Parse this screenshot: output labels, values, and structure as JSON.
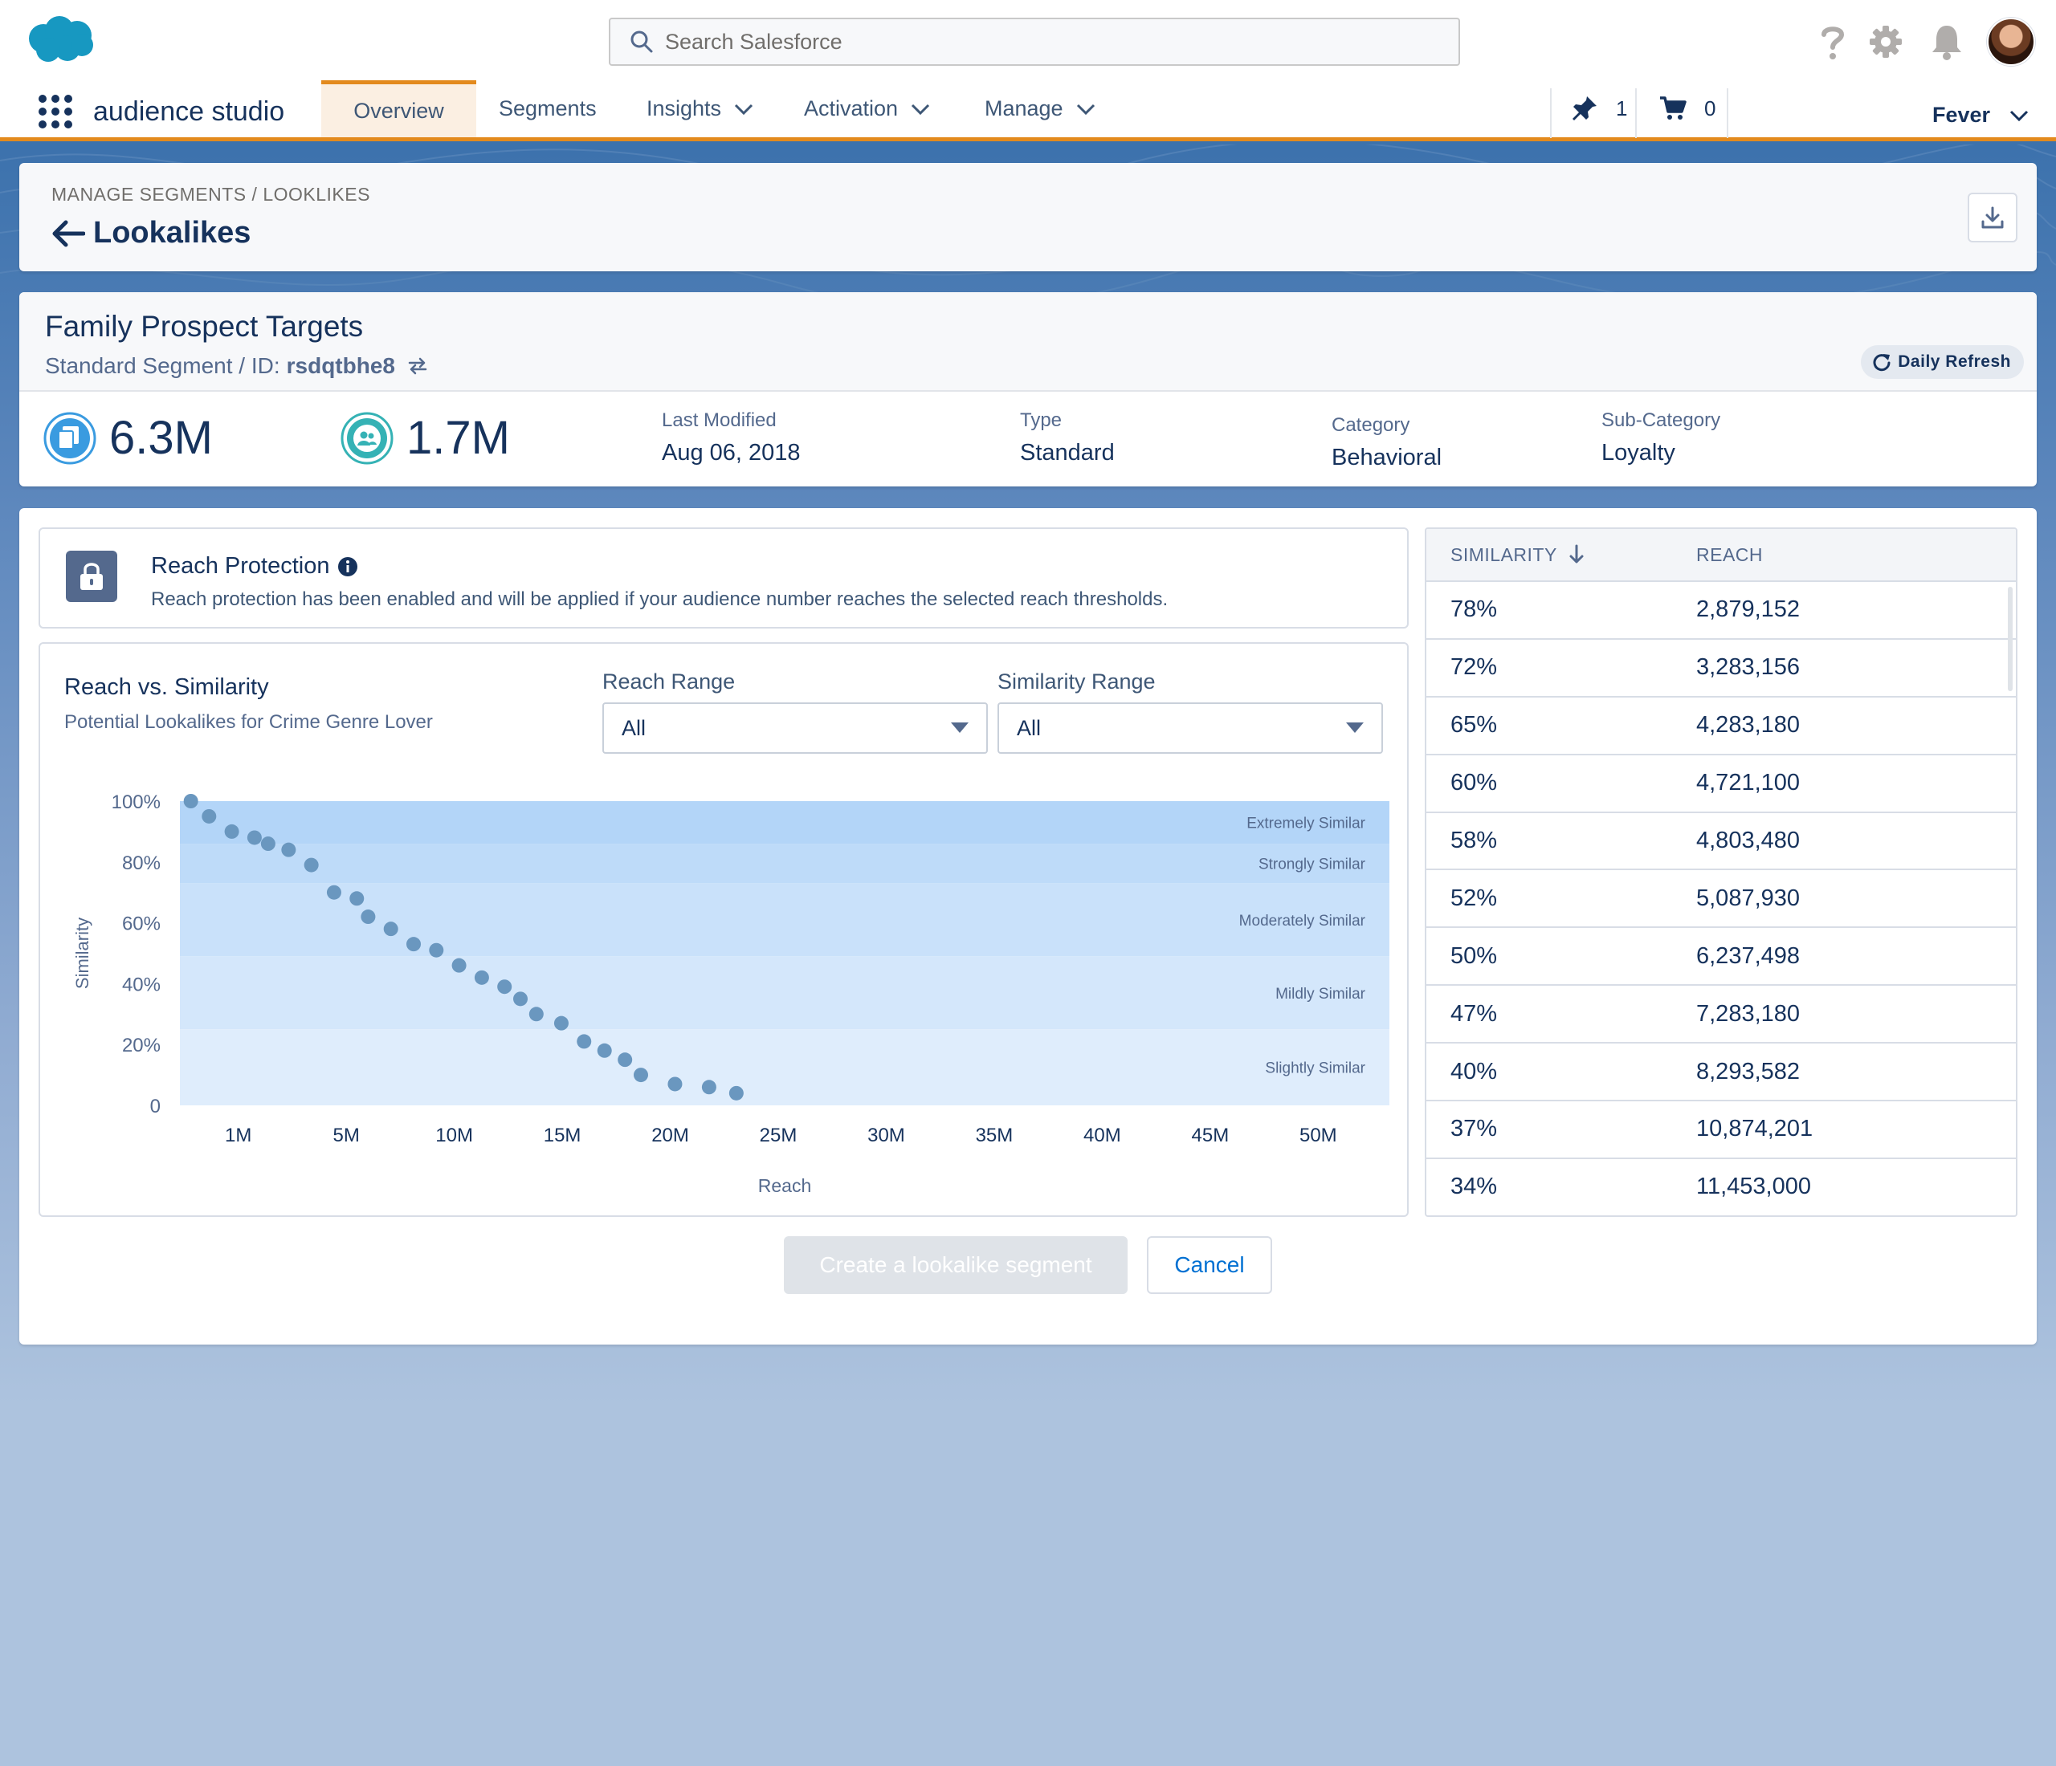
{
  "header": {
    "search_placeholder": "Search Salesforce",
    "icons": [
      "help-icon",
      "gear-icon",
      "bell-icon"
    ]
  },
  "nav": {
    "app_name": "audience studio",
    "tabs": [
      {
        "label": "Overview",
        "active": true
      },
      {
        "label": "Segments"
      },
      {
        "label": "Insights",
        "has_menu": true
      },
      {
        "label": "Activation",
        "has_menu": true
      },
      {
        "label": "Manage",
        "has_menu": true
      }
    ],
    "pin_count": "1",
    "cart_count": "0",
    "org_name": "Fever",
    "accent_color": "#e38a1d"
  },
  "page": {
    "breadcrumb": "MANAGE SEGMENTS / LOOKLIKES",
    "title": "Lookalikes"
  },
  "segment": {
    "name": "Family Prospect Targets",
    "subtype": "Standard Segment",
    "id_label": "/ ID:",
    "id": "rsdqtbhe8",
    "refresh_label": "Daily Refresh",
    "metric_1": "6.3M",
    "metric_2": "1.7M",
    "fields": [
      {
        "label": "Last Modified",
        "value": "Aug 06, 2018"
      },
      {
        "label": "Type",
        "value": "Standard"
      },
      {
        "label": "Category",
        "value": "Behavioral"
      },
      {
        "label": "Sub-Category",
        "value": "Loyalty"
      }
    ]
  },
  "reach_protection": {
    "title": "Reach Protection",
    "description": "Reach protection has been enabled and will be applied if your audience number reaches the selected reach thresholds."
  },
  "chart_panel": {
    "title": "Reach vs. Similarity",
    "subtitle": "Potential Lookalikes for Crime Genre Lover",
    "reach_range_label": "Reach Range",
    "reach_range_value": "All",
    "similarity_range_label": "Similarity Range",
    "similarity_range_value": "All"
  },
  "chart_data": {
    "type": "scatter",
    "title": "Reach vs. Similarity",
    "xlabel": "Reach",
    "ylabel": "Similarity",
    "x_ticks": [
      "1M",
      "5M",
      "10M",
      "15M",
      "20M",
      "25M",
      "30M",
      "35M",
      "40M",
      "45M",
      "50M"
    ],
    "y_ticks": [
      "0",
      "20%",
      "40%",
      "60%",
      "80%",
      "100%"
    ],
    "ylim": [
      0,
      100
    ],
    "point_color": "#6a97bf",
    "bands": [
      {
        "label": "Extremely Similar",
        "from": 86,
        "to": 100,
        "color": "#b3d5f8"
      },
      {
        "label": "Strongly Similar",
        "from": 73,
        "to": 86,
        "color": "#bedbf9"
      },
      {
        "label": "Moderately Similar",
        "from": 49,
        "to": 73,
        "color": "#c9e1fa"
      },
      {
        "label": "Mildly Similar",
        "from": 25,
        "to": 49,
        "color": "#d4e7fb"
      },
      {
        "label": "Slightly Similar",
        "from": 0,
        "to": 25,
        "color": "#dfedfc"
      }
    ],
    "points": [
      {
        "x": 0.2,
        "y": 100
      },
      {
        "x": 1.0,
        "y": 95
      },
      {
        "x": 2.0,
        "y": 90
      },
      {
        "x": 3.0,
        "y": 88
      },
      {
        "x": 3.6,
        "y": 86
      },
      {
        "x": 4.5,
        "y": 84
      },
      {
        "x": 5.5,
        "y": 79
      },
      {
        "x": 6.5,
        "y": 70
      },
      {
        "x": 7.5,
        "y": 68
      },
      {
        "x": 8.0,
        "y": 62
      },
      {
        "x": 9.0,
        "y": 58
      },
      {
        "x": 10.0,
        "y": 53
      },
      {
        "x": 11.0,
        "y": 51
      },
      {
        "x": 12.0,
        "y": 46
      },
      {
        "x": 13.0,
        "y": 42
      },
      {
        "x": 14.0,
        "y": 39
      },
      {
        "x": 14.7,
        "y": 35
      },
      {
        "x": 15.4,
        "y": 30
      },
      {
        "x": 16.5,
        "y": 27
      },
      {
        "x": 17.5,
        "y": 21
      },
      {
        "x": 18.4,
        "y": 18
      },
      {
        "x": 19.3,
        "y": 15
      },
      {
        "x": 20.0,
        "y": 10
      },
      {
        "x": 21.5,
        "y": 7
      },
      {
        "x": 23.0,
        "y": 6
      },
      {
        "x": 24.2,
        "y": 4
      }
    ]
  },
  "table": {
    "col_similarity": "SIMILARITY",
    "col_reach": "REACH",
    "rows": [
      {
        "similarity": "78%",
        "reach": "2,879,152"
      },
      {
        "similarity": "72%",
        "reach": "3,283,156"
      },
      {
        "similarity": "65%",
        "reach": "4,283,180"
      },
      {
        "similarity": "60%",
        "reach": "4,721,100"
      },
      {
        "similarity": "58%",
        "reach": "4,803,480"
      },
      {
        "similarity": "52%",
        "reach": "5,087,930"
      },
      {
        "similarity": "50%",
        "reach": "6,237,498"
      },
      {
        "similarity": "47%",
        "reach": "7,283,180"
      },
      {
        "similarity": "40%",
        "reach": "8,293,582"
      },
      {
        "similarity": "37%",
        "reach": "10,874,201"
      },
      {
        "similarity": "34%",
        "reach": "11,453,000"
      }
    ]
  },
  "actions": {
    "create_label": "Create a lookalike segment",
    "cancel_label": "Cancel"
  }
}
